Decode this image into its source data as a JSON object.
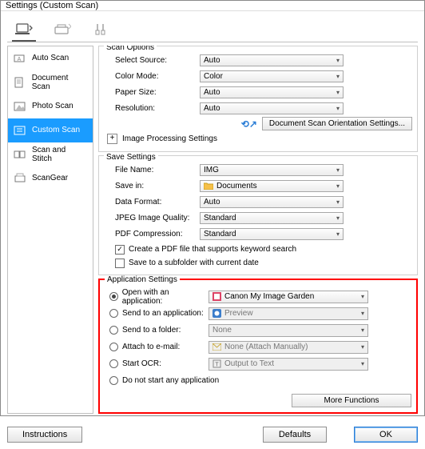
{
  "window": {
    "title": "Settings (Custom Scan)"
  },
  "sidebar": {
    "items": [
      {
        "label": "Auto Scan"
      },
      {
        "label": "Document Scan"
      },
      {
        "label": "Photo Scan"
      },
      {
        "label": "Custom Scan"
      },
      {
        "label": "Scan and Stitch"
      },
      {
        "label": "ScanGear"
      }
    ]
  },
  "scan_options": {
    "title": "Scan Options",
    "source_label": "Select Source:",
    "source_value": "Auto",
    "color_label": "Color Mode:",
    "color_value": "Color",
    "paper_label": "Paper Size:",
    "paper_value": "Auto",
    "res_label": "Resolution:",
    "res_value": "Auto",
    "orient_btn": "Document Scan Orientation Settings...",
    "imgproc_label": "Image Processing Settings"
  },
  "save_settings": {
    "title": "Save Settings",
    "filename_label": "File Name:",
    "filename_value": "IMG",
    "savein_label": "Save in:",
    "savein_value": "Documents",
    "format_label": "Data Format:",
    "format_value": "Auto",
    "jpeg_label": "JPEG Image Quality:",
    "jpeg_value": "Standard",
    "pdf_label": "PDF Compression:",
    "pdf_value": "Standard",
    "chk1": "Create a PDF file that supports keyword search",
    "chk2": "Save to a subfolder with current date"
  },
  "app_settings": {
    "title": "Application Settings",
    "r1": "Open with an application:",
    "r1v": "Canon My Image Garden",
    "r2": "Send to an application:",
    "r2v": "Preview",
    "r3": "Send to a folder:",
    "r3v": "None",
    "r4": "Attach to e-mail:",
    "r4v": "None (Attach Manually)",
    "r5": "Start OCR:",
    "r5v": "Output to Text",
    "r6": "Do not start any application",
    "more": "More Functions"
  },
  "footer": {
    "instructions": "Instructions",
    "defaults": "Defaults",
    "ok": "OK"
  }
}
